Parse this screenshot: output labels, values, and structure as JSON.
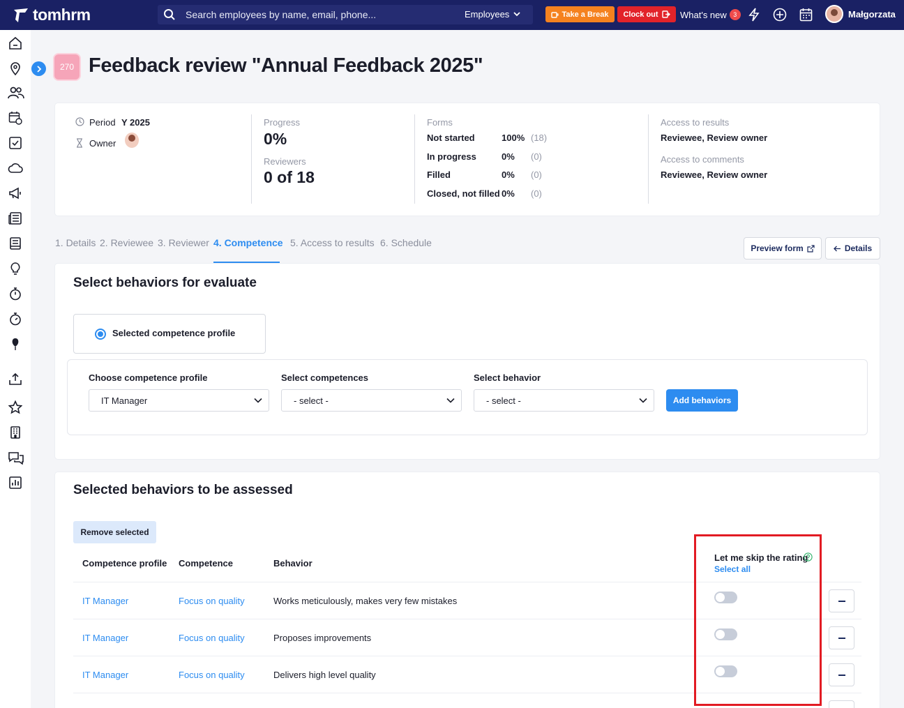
{
  "app": {
    "name": "tomhrm"
  },
  "topbar": {
    "search_placeholder": "Search employees by name, email, phone...",
    "search_scope": "Employees",
    "take_break": "Take a Break",
    "clock_out": "Clock out",
    "whats_new": "What's new",
    "whats_new_count": "3",
    "user_name": "Małgorzata"
  },
  "page": {
    "id_badge": "270",
    "title": "Feedback review \"Annual Feedback 2025\""
  },
  "summary": {
    "period_label": "Period",
    "period_value": "Y 2025",
    "owner_label": "Owner",
    "progress_label": "Progress",
    "progress_value": "0%",
    "reviewers_label": "Reviewers",
    "reviewers_value": "0 of 18",
    "forms_label": "Forms",
    "forms": [
      {
        "label": "Not started",
        "pct": "100%",
        "count": "(18)"
      },
      {
        "label": "In progress",
        "pct": "0%",
        "count": "(0)"
      },
      {
        "label": "Filled",
        "pct": "0%",
        "count": "(0)"
      },
      {
        "label": "Closed, not filled",
        "pct": "0%",
        "count": "(0)"
      }
    ],
    "access_results_label": "Access to results",
    "access_results_value": "Reviewee, Review owner",
    "access_comments_label": "Access to comments",
    "access_comments_value": "Reviewee, Review owner"
  },
  "tabs": [
    {
      "label": "1. Details"
    },
    {
      "label": "2. Reviewee"
    },
    {
      "label": "3. Reviewer"
    },
    {
      "label": "4. Competence",
      "active": true
    },
    {
      "label": "5. Access to results"
    },
    {
      "label": "6. Schedule"
    }
  ],
  "actions": {
    "preview_form": "Preview form",
    "details": "Details"
  },
  "select_section": {
    "title": "Select behaviors for evaluate",
    "radio_label": "Selected competence profile",
    "profile_label": "Choose competence profile",
    "profile_value": "IT Manager",
    "competences_label": "Select competences",
    "competences_value": "- select -",
    "behavior_label": "Select behavior",
    "behavior_value": "- select -",
    "add_button": "Add behaviors"
  },
  "assessed_section": {
    "title": "Selected behaviors to be assessed",
    "remove_button": "Remove selected",
    "headers": {
      "profile": "Competence profile",
      "competence": "Competence",
      "behavior": "Behavior",
      "skip": "Let me skip the rating",
      "select_all": "Select all"
    },
    "rows": [
      {
        "profile": "IT Manager",
        "competence": "Focus on quality",
        "behavior": "Works meticulously, makes very few mistakes",
        "skip": false
      },
      {
        "profile": "IT Manager",
        "competence": "Focus on quality",
        "behavior": "Proposes improvements",
        "skip": false
      },
      {
        "profile": "IT Manager",
        "competence": "Focus on quality",
        "behavior": "Delivers high level quality",
        "skip": false
      }
    ]
  },
  "colors": {
    "nav": "#1a2164",
    "accent": "#2d8cf0",
    "break": "#f5821f",
    "clockout": "#e2232a",
    "highlight": "#e21b23"
  }
}
